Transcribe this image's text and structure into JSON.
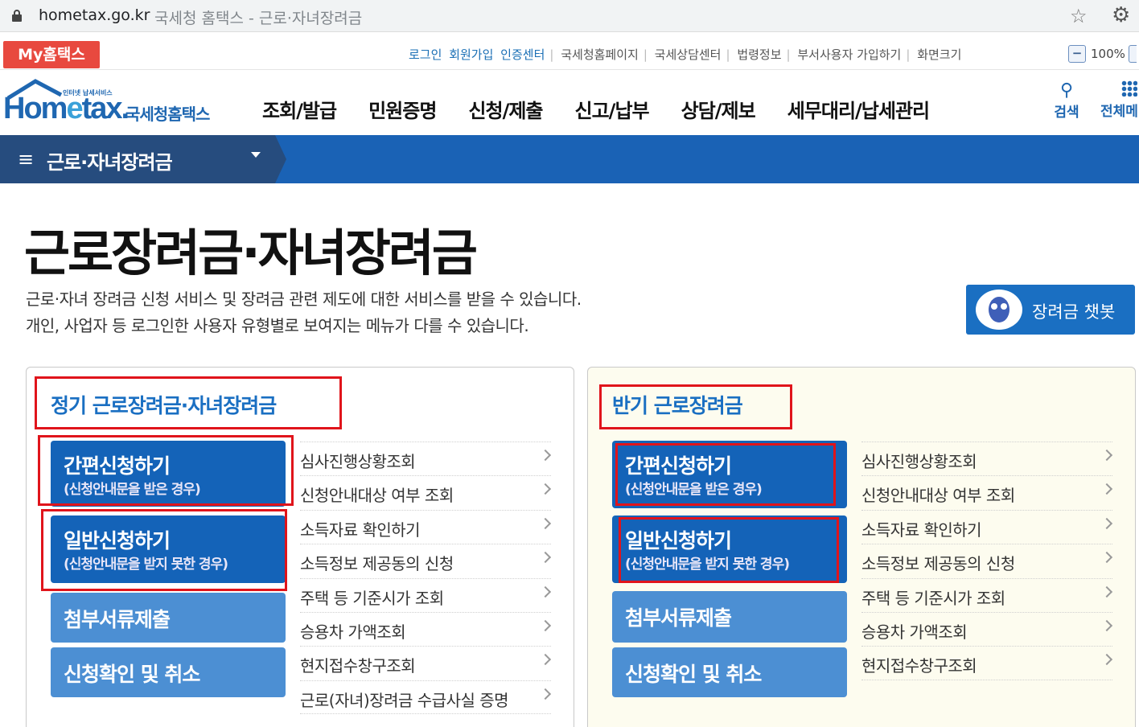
{
  "browser": {
    "domain": "hometax.go.kr",
    "page_title": "국세청 홈택스 - 근로·자녀장려금"
  },
  "util": {
    "my_hometax": "My홈택스",
    "links": [
      "로그인",
      "회원가입",
      "인증센터",
      "국세청홈페이지",
      "국세상담센터",
      "법령정보",
      "부서사용자 가입하기",
      "화면크기"
    ],
    "zoom": "100%"
  },
  "header": {
    "logo_small": "인터넷 납세서비스",
    "logo_brand_a": "Hom",
    "logo_brand_e": "e",
    "logo_brand_b": "tax.",
    "logo_kr": "국세청홈택스",
    "gnb": [
      "조회/발급",
      "민원증명",
      "신청/제출",
      "신고/납부",
      "상담/제보",
      "세무대리/납세관리"
    ],
    "search": "검색",
    "all_menu": "전체메"
  },
  "menubar": {
    "title": "근로·자녀장려금"
  },
  "page": {
    "title": "근로장려금·자녀장려금",
    "desc1": "근로·자녀 장려금 신청 서비스 및 장려금 관련 제도에 대한 서비스를 받을 수 있습니다.",
    "desc2": "개인, 사업자 등 로그인한 사용자 유형별로 보여지는 메뉴가 다를 수 있습니다.",
    "chatbot": "장려금 챗봇"
  },
  "left_panel": {
    "title": "정기 근로장려금·자녀장려금",
    "buttons": [
      {
        "main": "간편신청하기",
        "sub": "(신청안내문을 받은 경우)"
      },
      {
        "main": "일반신청하기",
        "sub": "(신청안내문을 받지 못한 경우)"
      },
      {
        "main": "첨부서류제출"
      },
      {
        "main": "신청확인 및 취소"
      }
    ],
    "links": [
      "심사진행상황조회",
      "신청안내대상 여부 조회",
      "소득자료 확인하기",
      "소득정보 제공동의 신청",
      "주택 등 기준시가 조회",
      "승용차 가액조회",
      "현지접수창구조회",
      "근로(자녀)장려금 수급사실 증명"
    ]
  },
  "right_panel": {
    "title": "반기 근로장려금",
    "buttons": [
      {
        "main": "간편신청하기",
        "sub": "(신청안내문을 받은 경우)"
      },
      {
        "main": "일반신청하기",
        "sub": "(신청안내문을 받지 못한 경우)"
      },
      {
        "main": "첨부서류제출"
      },
      {
        "main": "신청확인 및 취소"
      }
    ],
    "links": [
      "심사진행상황조회",
      "신청안내대상 여부 조회",
      "소득자료 확인하기",
      "소득정보 제공동의 신청",
      "주택 등 기준시가 조회",
      "승용차 가액조회",
      "현지접수창구조회"
    ]
  },
  "colors": {
    "brand_blue": "#1a6fc2",
    "menubar_blue": "#1a62b5",
    "highlight_red": "#e0141b"
  }
}
